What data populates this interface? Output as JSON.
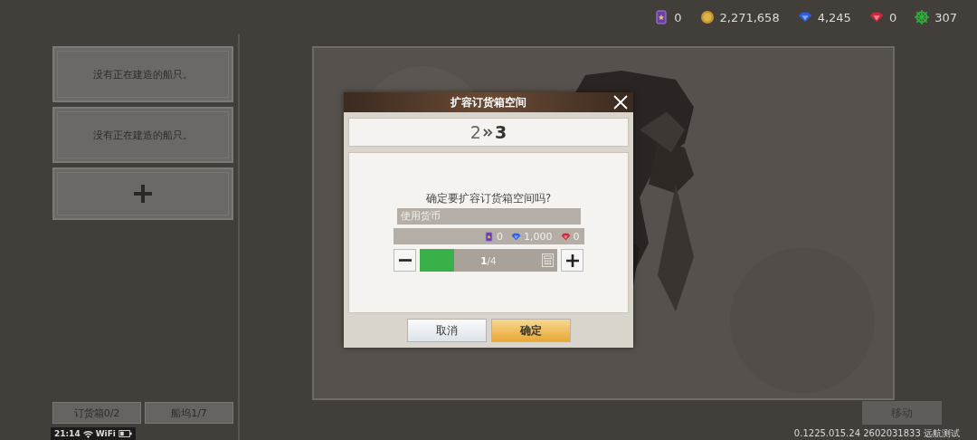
{
  "currencies": [
    {
      "kind": "card",
      "amount": "0"
    },
    {
      "kind": "coin",
      "amount": "2,271,658"
    },
    {
      "kind": "gem_blue",
      "amount": "4,245"
    },
    {
      "kind": "gem_red",
      "amount": "0"
    },
    {
      "kind": "wheel",
      "amount": "307"
    }
  ],
  "shipyard": {
    "slots": [
      {
        "kind": "empty",
        "text": "没有正在建造的船只。"
      },
      {
        "kind": "empty",
        "text": "没有正在建造的船只。"
      },
      {
        "kind": "add"
      }
    ],
    "tabs": [
      {
        "label": "订货箱0/2"
      },
      {
        "label": "船坞1/7"
      }
    ]
  },
  "move_button": {
    "label": "移动",
    "disabled": true
  },
  "version": "0.1225.015.24 2602031833 远航测试",
  "status_bar": {
    "time": "21:14",
    "network": "WiFi"
  },
  "dialog": {
    "title": "扩容订货箱空间",
    "from": "2",
    "to": "3",
    "question": "确定要扩容订货箱空间吗?",
    "currency_label": "使用货币",
    "costs": [
      {
        "kind": "card",
        "amount": "0"
      },
      {
        "kind": "gem_blue",
        "amount": "1,000"
      },
      {
        "kind": "gem_red",
        "amount": "0"
      }
    ],
    "quantity": {
      "level": 0.25,
      "reading": "**1**/4"
    },
    "buttons": [
      {
        "kind": "cancel",
        "label": "取消"
      },
      {
        "kind": "confirm",
        "label": "确定"
      }
    ]
  }
}
